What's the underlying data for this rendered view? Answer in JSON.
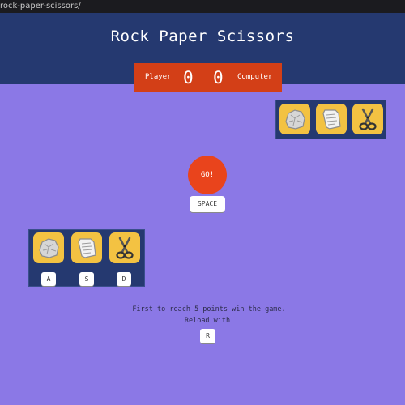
{
  "browser": {
    "url": "rock-paper-scissors/"
  },
  "game": {
    "title": "Rock Paper Scissors",
    "player_label": "Player",
    "computer_label": "Computer",
    "player_score": "0",
    "computer_score": "0"
  },
  "computer_choices": [
    {
      "name": "rock",
      "icon": "rock-icon"
    },
    {
      "name": "paper",
      "icon": "paper-icon"
    },
    {
      "name": "scissors",
      "icon": "scissors-icon"
    }
  ],
  "player_choices": [
    {
      "name": "rock",
      "icon": "rock-icon",
      "key": "A"
    },
    {
      "name": "paper",
      "icon": "paper-icon",
      "key": "S"
    },
    {
      "name": "scissors",
      "icon": "scissors-icon",
      "key": "D"
    }
  ],
  "go": {
    "label": "GO!",
    "key": "SPACE"
  },
  "info": {
    "line1": "First to reach 5 points win the game.",
    "line2": "Reload with",
    "reload_key": "R"
  },
  "colors": {
    "background": "#8b78e6",
    "header": "#253970",
    "scoreboard": "#d33f17",
    "choice_tile": "#f3c242",
    "go_button": "#e9441c"
  }
}
